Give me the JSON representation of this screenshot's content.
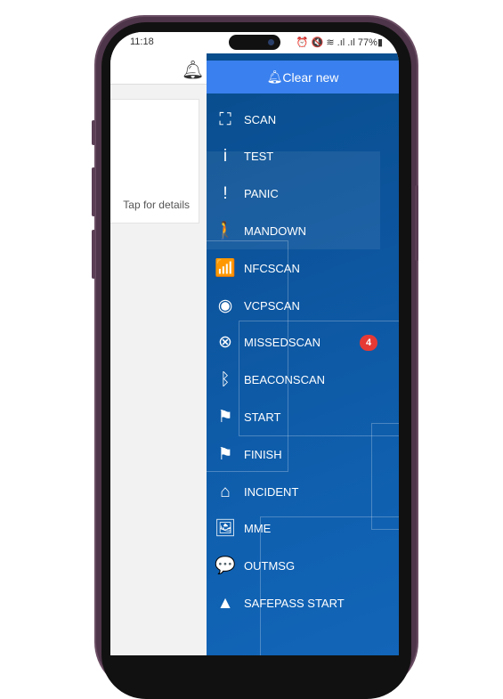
{
  "status_bar": {
    "time": "11:18",
    "icons": "⏰ 🔇 ≋ .ıl .ıl",
    "battery": "77%"
  },
  "left_panel": {
    "card_text": "Tap for details"
  },
  "drawer": {
    "clear_label": "Clear new",
    "items": [
      {
        "label": "SCAN",
        "icon": "scan-icon",
        "glyph": "⛶"
      },
      {
        "label": "TEST",
        "icon": "info-icon",
        "glyph": "i"
      },
      {
        "label": "PANIC",
        "icon": "exclamation-icon",
        "glyph": "!"
      },
      {
        "label": "MANDOWN",
        "icon": "walking-person-icon",
        "glyph": "🚶"
      },
      {
        "label": "NFCSCAN",
        "icon": "wifi-icon",
        "glyph": "📶"
      },
      {
        "label": "VCPSCAN",
        "icon": "radio-button-icon",
        "glyph": "◉"
      },
      {
        "label": "MISSEDSCAN",
        "icon": "cancel-circle-icon",
        "glyph": "⊗",
        "badge": "4"
      },
      {
        "label": "BEACONSCAN",
        "icon": "bluetooth-icon",
        "glyph": "ᛒ"
      },
      {
        "label": "START",
        "icon": "flag-icon",
        "glyph": "⚑"
      },
      {
        "label": "FINISH",
        "icon": "flag-icon",
        "glyph": "⚑"
      },
      {
        "label": "INCIDENT",
        "icon": "home-icon",
        "glyph": "⌂"
      },
      {
        "label": "MME",
        "icon": "images-icon",
        "glyph": "🖼"
      },
      {
        "label": "OUTMSG",
        "icon": "chat-icon",
        "glyph": "💬"
      },
      {
        "label": "SAFEPASS START",
        "icon": "road-icon",
        "glyph": "▲"
      }
    ]
  },
  "colors": {
    "drawer": "#0d56a0",
    "clear_button": "#3a80ee",
    "badge": "#e53935"
  }
}
